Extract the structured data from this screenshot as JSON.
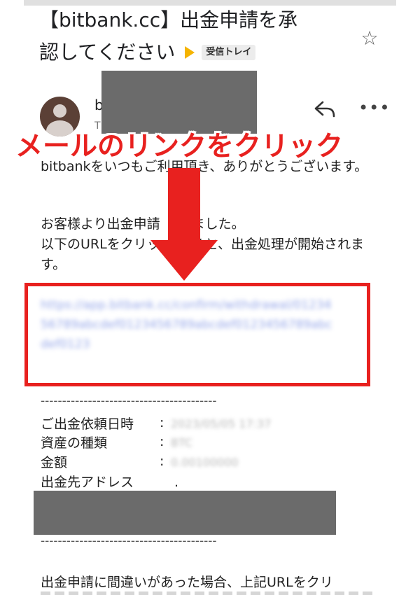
{
  "email": {
    "subject_line1": "【bitbank.cc】出金申請を承",
    "subject_line2": "認してください",
    "label_chip": "受信トレイ",
    "sender_initial": "b",
    "sender_sub": "T",
    "body_paragraph1": "bitbankをいつもご利用頂き、ありがとうございます。",
    "body_paragraph2_line1": "お客様より出金申請",
    "body_paragraph2_line1b": "りました。",
    "body_paragraph2_line2": "以下のURLをクリッ",
    "body_paragraph2_line2b": "すると、出金処理が開始されます。",
    "link_blurred": "https://app.bitbank.cc/confirm/withdrawal/0123456789abcdef0123456789abcdef0123456789abcdef0123",
    "divider": "-----------------------------------------",
    "details": [
      {
        "label": "ご出金依頼日時",
        "value": "2023/05/05 17:37"
      },
      {
        "label": "資産の種類",
        "value": "BTC"
      },
      {
        "label": "金額",
        "value": "0.00100000"
      },
      {
        "label": "出金先アドレス",
        "value": "."
      }
    ],
    "footer_text": "出金申請に間違いがあった場合、上記URLをクリ"
  },
  "annotation": {
    "callout_text": "メールのリンクをクリック",
    "accent_color": "#e8211f"
  },
  "icons": {
    "star": "star-outline-icon",
    "reply": "reply-icon",
    "more": "more-horizontal-icon",
    "avatar": "avatar-icon"
  }
}
